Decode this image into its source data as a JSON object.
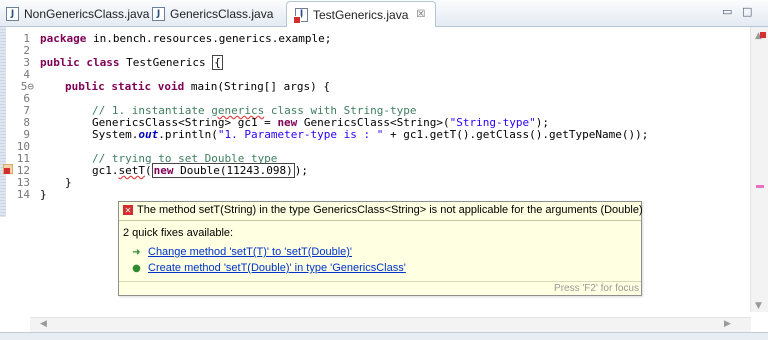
{
  "tabs": [
    {
      "label": "NonGenericsClass.java",
      "icon": "java-file-icon",
      "active": false
    },
    {
      "label": "GenericsClass.java",
      "icon": "java-file-icon",
      "active": false
    },
    {
      "label": "TestGenerics.java",
      "icon": "java-file-error-icon",
      "active": true,
      "close": "☒"
    }
  ],
  "window_controls": {
    "minimize": "▭",
    "maximize": "□"
  },
  "editor": {
    "line_numbers": [
      "1",
      "2",
      "3",
      "4",
      "5⊖",
      "6",
      "7",
      "8",
      "9",
      "10",
      "11",
      "12",
      "13",
      "14"
    ],
    "code": {
      "l1_kw": "package",
      "l1_rest": " in.bench.resources.generics.example;",
      "l3_kw1": "public",
      "l3_kw2": "class",
      "l3_name": " TestGenerics ",
      "l3_brace": "{",
      "l5_kw1": "public",
      "l5_kw2": "static",
      "l5_kw3": "void",
      "l5_rest": " main(String[] args) {",
      "l7_a": "// 1. instantiate ",
      "l7_b": "generics",
      "l7_c": " class with String-type",
      "l8_a": "GenericsClass<String> gc1 = ",
      "l8_kw": "new",
      "l8_b": " GenericsClass<String>(",
      "l8_str": "\"String-type\"",
      "l8_c": ");",
      "l9_a": "System.",
      "l9_out": "out",
      "l9_b": ".println(",
      "l9_str": "\"1. Parameter-type is : \"",
      "l9_c": " + gc1.getT().getClass().getTypeName());",
      "l11": "// trying to set Double type",
      "l12_a": "gc1.",
      "l12_m": "setT",
      "l12_b": "(",
      "l12_kw": "new",
      "l12_c": " Double(11243.098)",
      "l12_d": ");",
      "l13": "}",
      "l14": "}"
    }
  },
  "quickfix": {
    "message": "The method setT(String) in the type GenericsClass<String> is not applicable for the arguments (Double)",
    "count_text": "2 quick fixes available:",
    "fixes": [
      {
        "label": "Change method 'setT(T)' to 'setT(Double)'",
        "icon": "change-fix-icon"
      },
      {
        "label": "Create method 'setT(Double)' in type 'GenericsClass'",
        "icon": "create-fix-icon"
      }
    ],
    "status": "Press 'F2' for focus"
  },
  "colors": {
    "keyword": "#7f0055",
    "comment": "#3f7f5f",
    "string": "#2a00ff",
    "error": "#d32f2f",
    "popup_bg": "#ffffe1"
  }
}
